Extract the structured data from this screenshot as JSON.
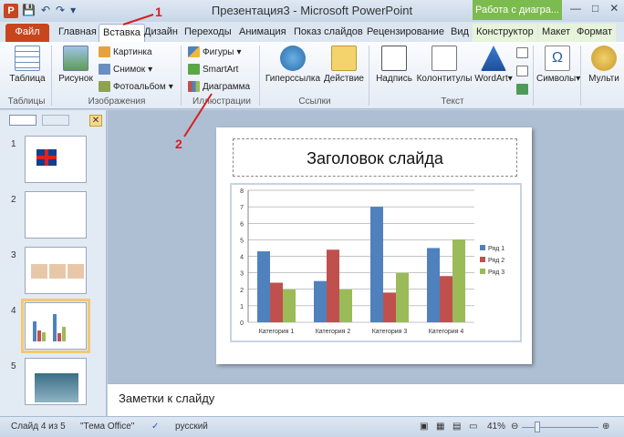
{
  "titlebar": {
    "title": "Презентация3 - Microsoft PowerPoint",
    "contextual_tab": "Работа с диагра...",
    "logo": "P",
    "minimize": "—",
    "maximize": "□",
    "close": "✕"
  },
  "tabs": [
    "Файл",
    "Главная",
    "Вставка",
    "Дизайн",
    "Переходы",
    "Анимация",
    "Показ слайдов",
    "Рецензирование",
    "Вид",
    "Конструктор",
    "Макет",
    "Формат"
  ],
  "ribbon": {
    "groups": {
      "tables": "Таблицы",
      "images": "Изображения",
      "illustrations": "Иллюстрации",
      "links": "Ссылки",
      "text": "Текст"
    },
    "buttons": {
      "table": "Таблица",
      "picture": "Рисунок",
      "clipart": "Картинка",
      "screenshot": "Снимок",
      "photo_album": "Фотоальбом",
      "shapes": "Фигуры",
      "smartart": "SmartArt",
      "chart": "Диаграмма",
      "hyperlink": "Гиперссылка",
      "action": "Действие",
      "textbox": "Надпись",
      "header_footer": "Колонтитулы",
      "wordart": "WordArt",
      "symbols": "Символы",
      "media": "Мульти"
    }
  },
  "slides_panel": {
    "close": "✕",
    "numbers": [
      "1",
      "2",
      "3",
      "4",
      "5"
    ],
    "selected": "4"
  },
  "slide": {
    "title": "Заголовок слайда"
  },
  "notes": {
    "placeholder": "Заметки к слайду"
  },
  "status": {
    "slide_info": "Слайд 4 из 5",
    "theme": "\"Тема Office\"",
    "language": "русский",
    "zoom": "41%"
  },
  "annotations": [
    "1",
    "2"
  ],
  "colors": {
    "series1": "#4f81bd",
    "series2": "#c0504d",
    "series3": "#9bbb59",
    "accent": "#c8461d",
    "context": "#7cbb4e"
  },
  "chart_data": {
    "type": "bar",
    "categories": [
      "Категория 1",
      "Категория 2",
      "Категория 3",
      "Категория 4"
    ],
    "series": [
      {
        "name": "Ряд 1",
        "values": [
          4.3,
          2.5,
          7,
          4.5
        ]
      },
      {
        "name": "Ряд 2",
        "values": [
          2.4,
          4.4,
          1.8,
          2.8
        ]
      },
      {
        "name": "Ряд 3",
        "values": [
          2,
          2,
          3,
          5
        ]
      }
    ],
    "yticks": [
      "0",
      "1",
      "2",
      "3",
      "4",
      "5",
      "6",
      "7",
      "8"
    ],
    "ylim": [
      0,
      8
    ],
    "legend": "right",
    "grid": true
  }
}
